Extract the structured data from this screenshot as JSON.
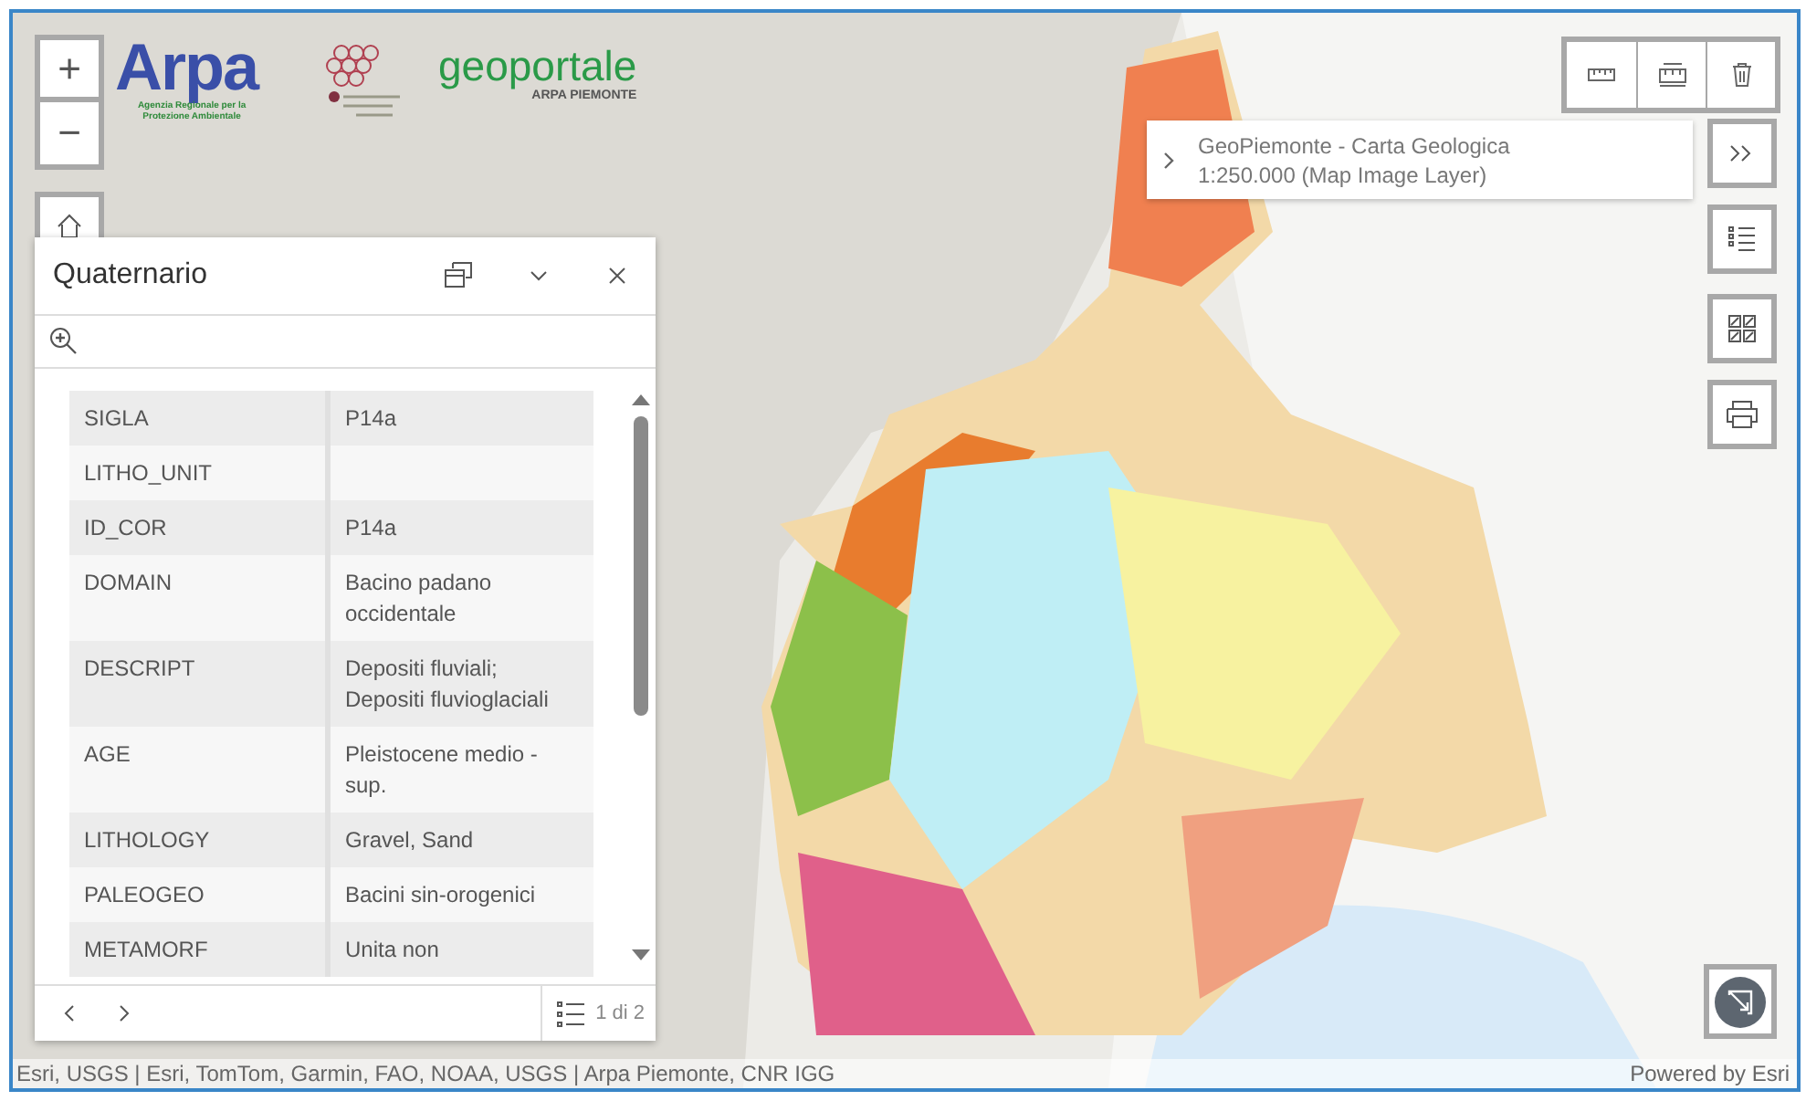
{
  "logos": {
    "arpa": {
      "wordmark": "Arpa",
      "caption": "Agenzia Regionale per la Protezione Ambientale"
    },
    "geoportale": {
      "wordmark": "geoportale",
      "caption": "ARPA PIEMONTE"
    }
  },
  "zoom_controls": {
    "zoom_in": "+",
    "zoom_out": "−"
  },
  "layer_tooltip": {
    "title": "GeoPiemonte - Carta Geologica",
    "subtitle": "1:250.000 (Map Image Layer)"
  },
  "popup": {
    "title": "Quaternario",
    "fields": [
      {
        "name": "SIGLA",
        "value": "P14a"
      },
      {
        "name": "LITHO_UNIT"
      },
      {
        "name": "ID_COR",
        "value": "P14a"
      },
      {
        "name": "DOMAIN",
        "value": "Bacino padano occidentale"
      },
      {
        "name": "DESCRIPT",
        "value": "Depositi fluviali; Depositi fluvioglaciali"
      },
      {
        "name": "AGE",
        "value": "Pleistocene medio - sup."
      },
      {
        "name": "LITHOLOGY",
        "value": "Gravel, Sand"
      },
      {
        "name": "PALEOGEO",
        "value": "Bacini sin-orogenici"
      },
      {
        "name": "METAMORF",
        "value": "Unita non"
      }
    ],
    "pager": "1 di 2"
  },
  "attribution": {
    "sources": "Esri, USGS | Esri, TomTom, Garmin, FAO, NOAA, USGS | Arpa Piemonte, CNR IGG",
    "powered_by": "Powered by Esri"
  }
}
